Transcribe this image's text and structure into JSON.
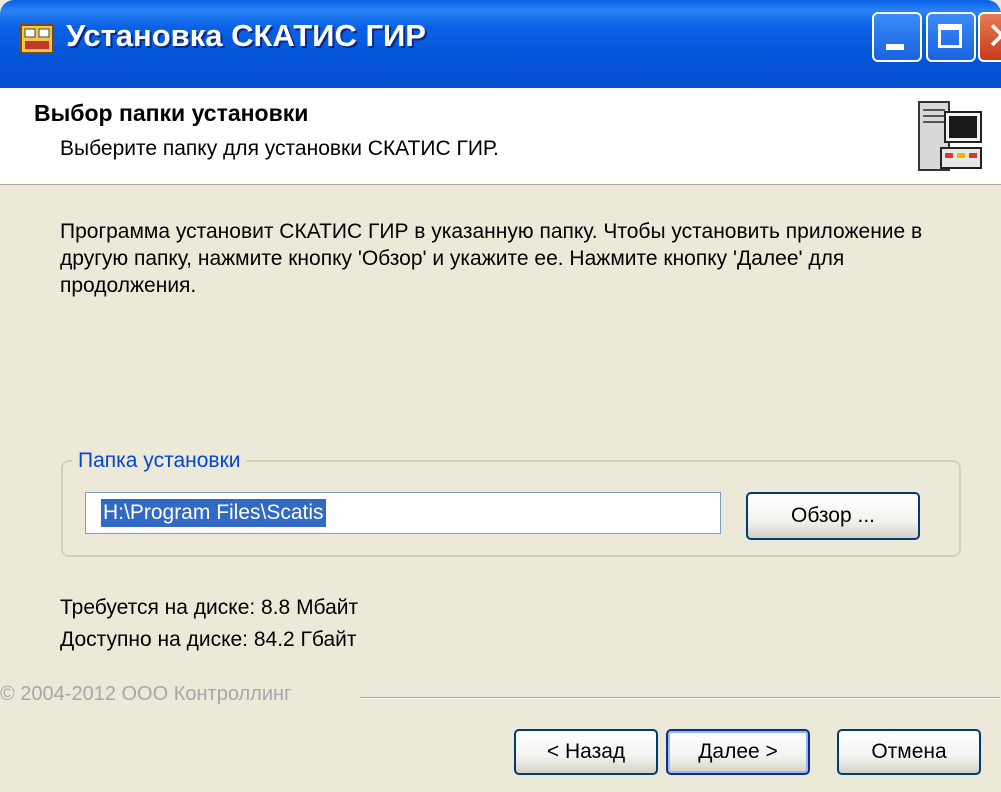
{
  "window": {
    "title": "Установка СКАТИС ГИР",
    "icons": [
      "installer-icon",
      "minimize-icon",
      "maximize-icon",
      "close-icon"
    ]
  },
  "header": {
    "title": "Выбор папки установки",
    "subtitle": "Выберите папку для установки СКАТИС ГИР.",
    "icon": "computer-icon"
  },
  "intro_text": "Программа установит СКАТИС ГИР в указанную папку. Чтобы установить приложение в другую папку, нажмите кнопку 'Обзор' и укажите ее. Нажмите кнопку 'Далее' для продолжения.",
  "install_group": {
    "label": "Папка установки",
    "path_value": "H:\\Program Files\\Scatis",
    "browse_label": "Обзор ..."
  },
  "disk": {
    "required": "Требуется на диске: 8.8 Мбайт",
    "available": "Доступно на диске: 84.2 Гбайт"
  },
  "copyright": "© 2004-2012 ООО Контроллинг",
  "buttons": {
    "back": "< Назад",
    "next": "Далее >",
    "cancel": "Отмена"
  },
  "colors": {
    "titlebar": "#0453d6",
    "window_bg": "#ece9d8",
    "group_label": "#0046d5",
    "selection": "#316ac5"
  }
}
